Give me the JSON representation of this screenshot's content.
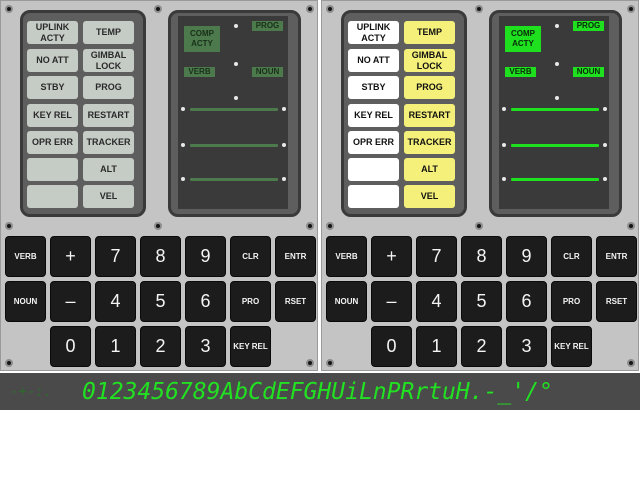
{
  "left_dsky": {
    "lamps": [
      {
        "label": "UPLINK ACTY",
        "state": "off"
      },
      {
        "label": "TEMP",
        "state": "off"
      },
      {
        "label": "NO ATT",
        "state": "off"
      },
      {
        "label": "GIMBAL LOCK",
        "state": "off"
      },
      {
        "label": "STBY",
        "state": "off"
      },
      {
        "label": "PROG",
        "state": "off"
      },
      {
        "label": "KEY REL",
        "state": "off"
      },
      {
        "label": "RESTART",
        "state": "off"
      },
      {
        "label": "OPR ERR",
        "state": "off"
      },
      {
        "label": "TRACKER",
        "state": "off"
      },
      {
        "label": "",
        "state": "off"
      },
      {
        "label": "ALT",
        "state": "off"
      },
      {
        "label": "",
        "state": "off"
      },
      {
        "label": "VEL",
        "state": "off"
      }
    ],
    "display": {
      "comp_acty": "COMP ACTY",
      "prog": "PROG",
      "verb": "VERB",
      "noun": "NOUN",
      "state": "dim"
    }
  },
  "right_dsky": {
    "lamps": [
      {
        "label": "UPLINK ACTY",
        "state": "white"
      },
      {
        "label": "TEMP",
        "state": "yellow"
      },
      {
        "label": "NO ATT",
        "state": "white"
      },
      {
        "label": "GIMBAL LOCK",
        "state": "yellow"
      },
      {
        "label": "STBY",
        "state": "white"
      },
      {
        "label": "PROG",
        "state": "yellow"
      },
      {
        "label": "KEY REL",
        "state": "white"
      },
      {
        "label": "RESTART",
        "state": "yellow"
      },
      {
        "label": "OPR ERR",
        "state": "white"
      },
      {
        "label": "TRACKER",
        "state": "yellow"
      },
      {
        "label": "",
        "state": "white"
      },
      {
        "label": "ALT",
        "state": "yellow"
      },
      {
        "label": "",
        "state": "white"
      },
      {
        "label": "VEL",
        "state": "yellow"
      }
    ],
    "display": {
      "comp_acty": "COMP ACTY",
      "prog": "PROG",
      "verb": "VERB",
      "noun": "NOUN",
      "state": "lit"
    }
  },
  "keypad": {
    "row1": [
      "VERB",
      "+",
      "7",
      "8",
      "9",
      "CLR",
      "ENTR"
    ],
    "row2": [
      "NOUN",
      "–",
      "4",
      "5",
      "6",
      "PRO",
      "RSET"
    ],
    "row3": [
      "0",
      "1",
      "2",
      "3",
      "KEY REL"
    ]
  },
  "segment_strip": {
    "dim_prefix": "-+-:.",
    "text": "0123456789AbCdEFGHUiLnPRrtuH.-_'/°"
  },
  "colors": {
    "lit_green": "#1ee01e",
    "dim_green": "#4d7a4d",
    "lamp_yellow": "#f5f07a",
    "lamp_white": "#ffffff",
    "lamp_off": "#c5cbc5"
  }
}
